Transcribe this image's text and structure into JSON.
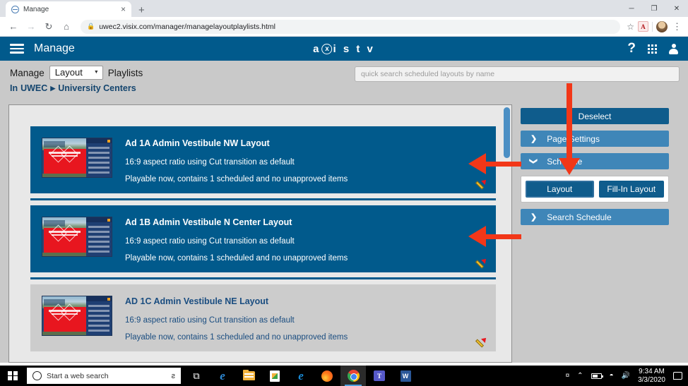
{
  "browser": {
    "tab_title": "Manage",
    "tab_close": "×",
    "new_tab": "+",
    "back": "←",
    "forward": "→",
    "reload": "↻",
    "home": "⌂",
    "lock": "🔒",
    "url": "uwec2.visix.com/manager/managelayoutplaylists.html",
    "star": "☆",
    "acrobat_label": "A",
    "kebab": "⋮",
    "minimize": "─",
    "maximize": "❐",
    "close": "✕"
  },
  "app_header": {
    "title": "Manage",
    "brand_prefix": "a",
    "brand_x": "x",
    "brand_suffix": "i s t v",
    "help": "?"
  },
  "subnav": {
    "manage_label": "Manage",
    "type_selected": "Layout",
    "type_caret": "▼",
    "playlists_label": "Playlists",
    "breadcrumb_in": "In",
    "breadcrumb_root": "UWEC",
    "breadcrumb_sep": "▶",
    "breadcrumb_current": "University Centers",
    "search_placeholder": "quick search scheduled layouts by name"
  },
  "playlists": [
    {
      "title": "Ad 1A Admin Vestibule NW Layout",
      "aspect": "16:9 aspect ratio using Cut transition as default",
      "status": "Playable now, contains 1 scheduled and no unapproved items",
      "selected": true
    },
    {
      "title": "Ad 1B Admin Vestibule N Center Layout",
      "aspect": "16:9 aspect ratio using Cut transition as default",
      "status": "Playable now, contains 1 scheduled and no unapproved items",
      "selected": true
    },
    {
      "title": "AD 1C Admin Vestibule NE Layout",
      "aspect": "16:9 aspect ratio using Cut transition as default",
      "status": "Playable now, contains 1 scheduled and no unapproved items",
      "selected": false
    }
  ],
  "sidebar": {
    "deselect_label": "Deselect",
    "page_settings_label": "Page Settings",
    "page_settings_chevron": "❯",
    "schedule_label": "Schedule",
    "schedule_chevron": "❯",
    "layout_button": "Layout",
    "fillin_button": "Fill-In Layout",
    "search_schedule_label": "Search Schedule",
    "search_schedule_chevron": "❯"
  },
  "taskbar": {
    "search_placeholder": "Start a web search",
    "mic": "ƨ",
    "apps": [
      {
        "name": "task-view",
        "glyph": "⧉"
      },
      {
        "name": "edge",
        "glyph": "e"
      },
      {
        "name": "file-explorer",
        "glyph": ""
      },
      {
        "name": "microsoft-store",
        "glyph": ""
      },
      {
        "name": "internet-explorer",
        "glyph": "e"
      },
      {
        "name": "firefox",
        "glyph": ""
      },
      {
        "name": "chrome",
        "glyph": ""
      },
      {
        "name": "microsoft-teams",
        "glyph": "T"
      },
      {
        "name": "microsoft-word",
        "glyph": "W"
      }
    ],
    "tray_people": "¤",
    "tray_chevron": "⌃",
    "time": "9:34 AM",
    "date": "3/3/2020"
  },
  "colors": {
    "brand_blue": "#015A8C",
    "section_blue": "#3f86b8",
    "annotation_red": "#f23718",
    "subnav_grey": "#c9c9c9"
  }
}
